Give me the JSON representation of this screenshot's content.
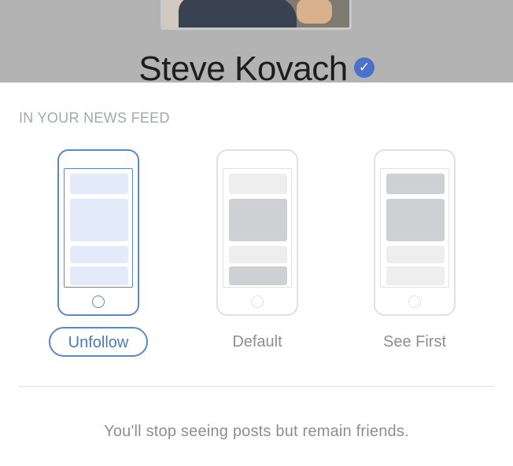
{
  "header": {
    "profile_name": "Steve Kovach",
    "verified_icon": "verified-badge-icon"
  },
  "news_feed": {
    "section_label": "IN YOUR NEWS FEED",
    "options": [
      {
        "label": "Unfollow",
        "selected": true,
        "icon": "phone-unfollow-icon"
      },
      {
        "label": "Default",
        "selected": false,
        "icon": "phone-default-icon"
      },
      {
        "label": "See First",
        "selected": false,
        "icon": "phone-see-first-icon"
      }
    ],
    "description": "You'll stop seeing posts but remain friends."
  },
  "colors": {
    "accent": "#5b88c9",
    "selected_fill": "#e3ebfb",
    "overlay": "#b3b3b3",
    "muted_text": "#8b8e93"
  }
}
